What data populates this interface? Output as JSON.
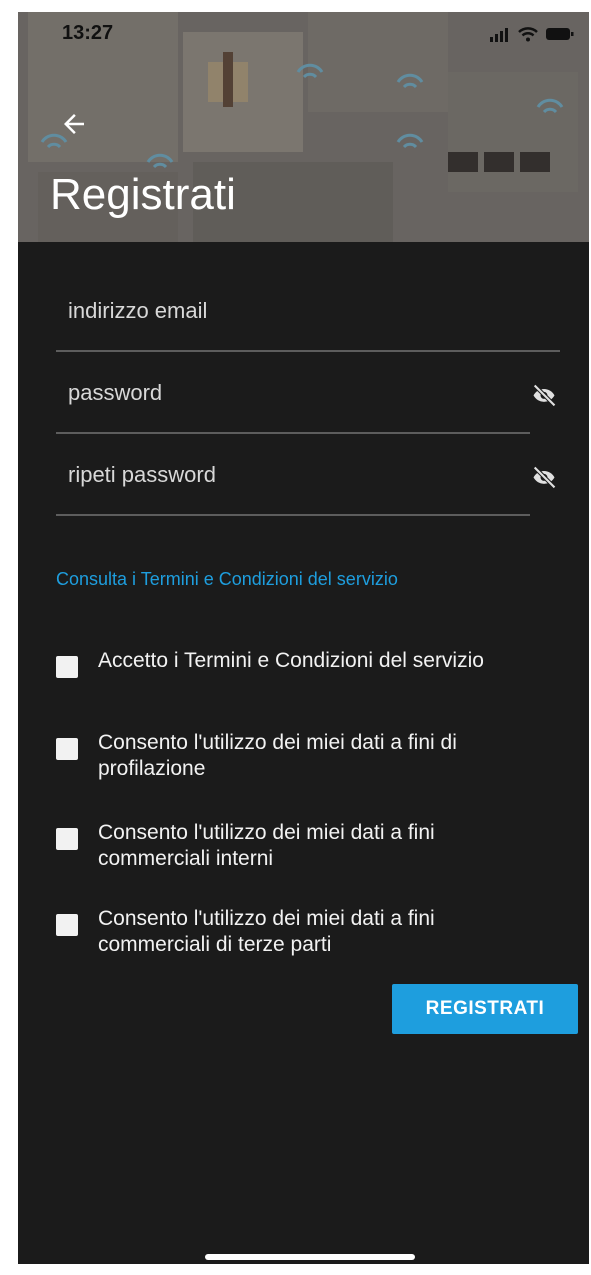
{
  "status_bar": {
    "time": "13:27",
    "icons": [
      "signal-icon",
      "wifi-icon",
      "battery-icon"
    ]
  },
  "header": {
    "back_icon": "arrow-left-icon",
    "title": "Registrati"
  },
  "form": {
    "email_placeholder": "indirizzo email",
    "password_placeholder": "password",
    "repeat_password_placeholder": "ripeti password",
    "visibility_icon": "eye-off-icon"
  },
  "terms_link": "Consulta i Termini e Condizioni del servizio",
  "checkboxes": [
    {
      "label": "Accetto i Termini e Condizioni del servizio",
      "checked": false
    },
    {
      "label": "Consento l'utilizzo dei miei dati a fini di profilazione",
      "checked": false
    },
    {
      "label": "Consento l'utilizzo dei miei dati a fini commerciali interni",
      "checked": false
    },
    {
      "label": "Consento l'utilizzo dei miei dati a fini commerciali di terze parti",
      "checked": false
    }
  ],
  "submit_label": "REGISTRATI",
  "colors": {
    "background": "#1b1b1b",
    "accent": "#1e9ede",
    "text": "#f2f2f2"
  }
}
